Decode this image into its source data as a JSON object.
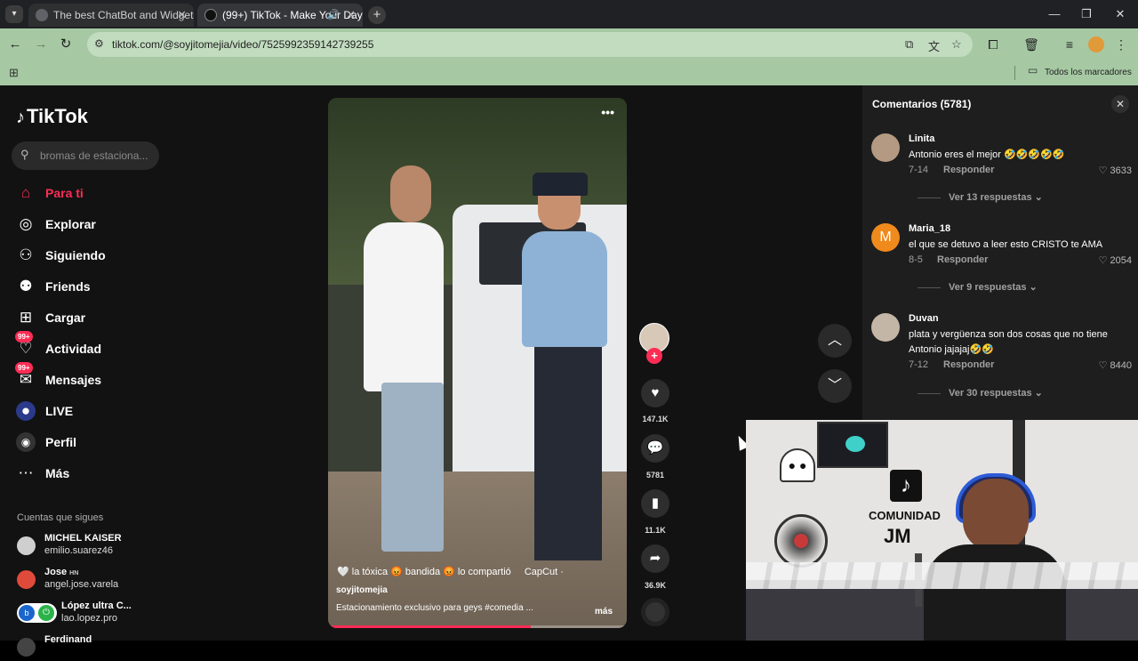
{
  "browser": {
    "tabs": [
      {
        "label": "The best ChatBot and Widgets",
        "active": false
      },
      {
        "label": "(99+) TikTok - Make Your Day",
        "active": true
      }
    ],
    "url": "tiktok.com/@soyjitomejia/video/7525992359142739255",
    "bookmarks_all": "Todos los marcadores",
    "bar_color": "#a6c9a4"
  },
  "sidebar": {
    "logo": "TikTok",
    "search_placeholder": "bromas de estaciona...",
    "items": [
      {
        "label": "Para ti",
        "icon": "home-icon",
        "active": true
      },
      {
        "label": "Explorar",
        "icon": "compass-icon"
      },
      {
        "label": "Siguiendo",
        "icon": "following-icon"
      },
      {
        "label": "Friends",
        "icon": "friends-icon"
      },
      {
        "label": "Cargar",
        "icon": "upload-icon"
      },
      {
        "label": "Actividad",
        "icon": "activity-icon",
        "badge": "99+"
      },
      {
        "label": "Mensajes",
        "icon": "messages-icon",
        "badge": "99+"
      },
      {
        "label": "LIVE",
        "icon": "live-icon"
      },
      {
        "label": "Perfil",
        "icon": "profile-icon"
      },
      {
        "label": "Más",
        "icon": "more-icon"
      }
    ],
    "following_title": "Cuentas que sigues",
    "following": [
      {
        "name": "MICHEL KAISER",
        "user": "emilio.suarez46"
      },
      {
        "name": "Jose",
        "suffix": "HN",
        "user": "angel.jose.varela"
      },
      {
        "name": "López ultra C...",
        "user": "lao.lopez.pro"
      },
      {
        "name": "Ferdinand",
        "user": ""
      }
    ]
  },
  "video": {
    "tags": "🤍 la tóxica 😡 bandida 😡 lo compartió",
    "capcut": "CapCut ·",
    "user": "soyjitomejia",
    "description": "Estacionamiento exclusivo para geys #comedia ...",
    "more": "más",
    "progress": 0.68
  },
  "rail": {
    "likes": "147.1K",
    "comments": "5781",
    "saves": "11.1K",
    "shares": "36.9K"
  },
  "comments": {
    "title": "Comentarios (5781)",
    "items": [
      {
        "name": "Linita",
        "text": "Antonio eres el mejor 🤣🤣🤣🤣🤣",
        "date": "7-14",
        "reply": "Responder",
        "likes": "3633",
        "more": "Ver 13 respuestas"
      },
      {
        "name": "Maria_18",
        "avatar_letter": "M",
        "text": "el que se detuvo a leer esto CRISTO te AMA",
        "date": "8-5",
        "reply": "Responder",
        "likes": "2054",
        "more": "Ver 9 respuestas"
      },
      {
        "name": "Duvan",
        "text": "plata y vergüenza son dos cosas que no tiene Antonio jajajaj🤣🤣",
        "date": "7-12",
        "reply": "Responder",
        "likes": "8440",
        "more": "Ver 30 respuestas"
      }
    ]
  },
  "webcam": {
    "sign_line1": "COMUNIDAD",
    "sign_line2": "JM"
  }
}
